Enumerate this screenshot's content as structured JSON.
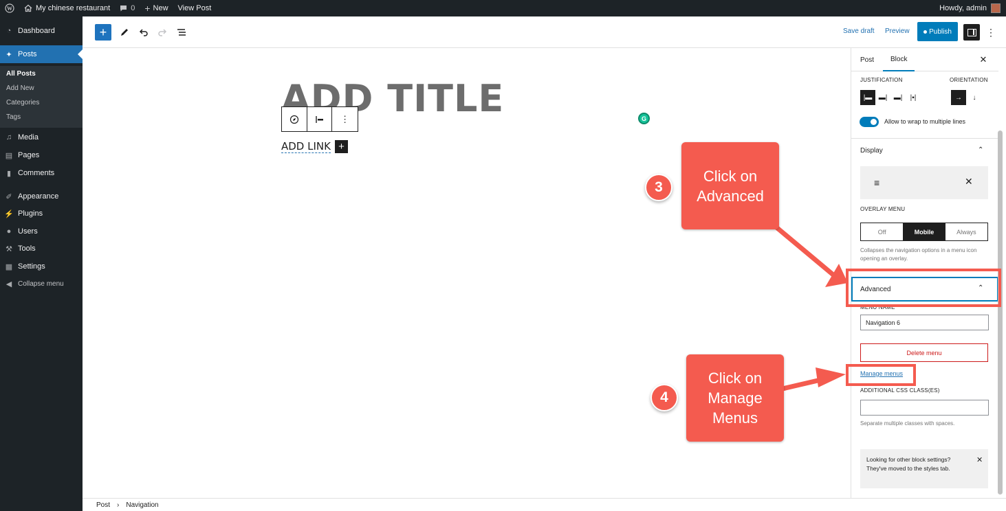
{
  "admin_bar": {
    "site_name": "My chinese restaurant",
    "comments_count": "0",
    "new_label": "New",
    "view_post_label": "View Post",
    "greeting": "Howdy, admin"
  },
  "admin_menu": {
    "dashboard": "Dashboard",
    "posts": "Posts",
    "posts_submenu": [
      "All Posts",
      "Add New",
      "Categories",
      "Tags"
    ],
    "media": "Media",
    "pages": "Pages",
    "comments": "Comments",
    "appearance": "Appearance",
    "plugins": "Plugins",
    "users": "Users",
    "tools": "Tools",
    "settings": "Settings",
    "collapse": "Collapse menu"
  },
  "header": {
    "save_draft": "Save draft",
    "preview": "Preview",
    "publish": "Publish"
  },
  "canvas": {
    "title_placeholder": "ADD TITLE",
    "add_link": "ADD LINK"
  },
  "breadcrumb": {
    "items": [
      "Post",
      "Navigation"
    ]
  },
  "sidebar": {
    "tabs": [
      "Post",
      "Block"
    ],
    "active_tab": "Block",
    "justification_label": "JUSTIFICATION",
    "orientation_label": "ORIENTATION",
    "wrap_toggle_label": "Allow to wrap to multiple lines",
    "wrap_toggle_on": true,
    "display_title": "Display",
    "overlay_menu_label": "OVERLAY MENU",
    "overlay_options": [
      "Off",
      "Mobile",
      "Always"
    ],
    "overlay_selected": "Mobile",
    "overlay_help": "Collapses the navigation options in a menu icon opening an overlay.",
    "advanced_title": "Advanced",
    "menu_name_label": "MENU NAME",
    "menu_name_value": "Navigation 6",
    "delete_menu": "Delete menu",
    "manage_menus": "Manage menus",
    "css_label": "ADDITIONAL CSS CLASS(ES)",
    "css_value": "",
    "css_help": "Separate multiple classes with spaces.",
    "notice": "Looking for other block settings? They've moved to the styles tab."
  },
  "annotations": {
    "step3_number": "3",
    "step3_text": "Click on Advanced",
    "step4_number": "4",
    "step4_text": "Click on Manage Menus",
    "color": "#f45b4f"
  },
  "colors": {
    "admin_dark": "#1d2327",
    "accent": "#007cba",
    "danger": "#cc1818"
  }
}
